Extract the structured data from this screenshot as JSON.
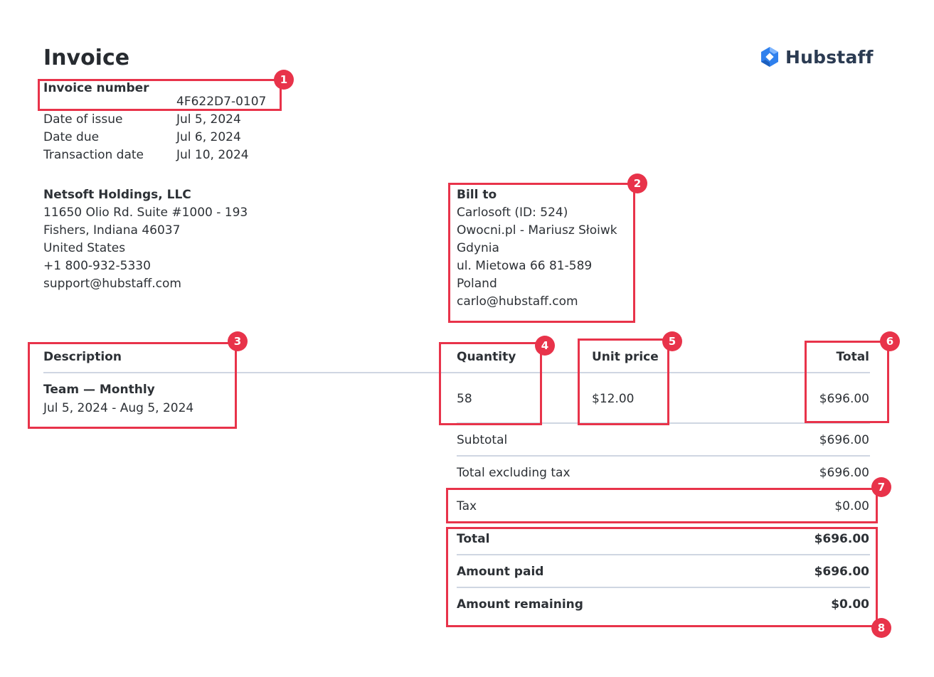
{
  "header": {
    "title": "Invoice",
    "brand": "Hubstaff"
  },
  "invoice_meta": {
    "number_label": "Invoice number",
    "number_value": "4F622D7-0107",
    "rows": [
      {
        "label": "Date of issue",
        "value": "Jul 5, 2024"
      },
      {
        "label": "Date due",
        "value": "Jul 6, 2024"
      },
      {
        "label": "Transaction date",
        "value": "Jul 10, 2024"
      }
    ]
  },
  "seller": {
    "name": "Netsoft Holdings, LLC",
    "lines": [
      "11650 Olio Rd. Suite #1000 - 193",
      "Fishers, Indiana 46037",
      "United States",
      "+1 800-932-5330",
      "support@hubstaff.com"
    ]
  },
  "bill_to": {
    "label": "Bill to",
    "lines": [
      "Carlosoft (ID: 524)",
      "Owocni.pl - Mariusz Słoiwk",
      "Gdynia",
      "ul. Mietowa 66 81-589",
      "Poland",
      "carlo@hubstaff.com"
    ]
  },
  "line_items": {
    "headers": {
      "description": "Description",
      "quantity": "Quantity",
      "unit_price": "Unit price",
      "total": "Total"
    },
    "rows": [
      {
        "name": "Team — Monthly",
        "period": "Jul 5, 2024 - Aug 5, 2024",
        "quantity": "58",
        "unit_price": "$12.00",
        "total": "$696.00"
      }
    ]
  },
  "summary": [
    {
      "label": "Subtotal",
      "value": "$696.00",
      "bold": false
    },
    {
      "label": "Total excluding tax",
      "value": "$696.00",
      "bold": false
    },
    {
      "label": "Tax",
      "value": "$0.00",
      "bold": false
    },
    {
      "label": "Total",
      "value": "$696.00",
      "bold": true
    },
    {
      "label": "Amount paid",
      "value": "$696.00",
      "bold": true
    },
    {
      "label": "Amount remaining",
      "value": "$0.00",
      "bold": true
    }
  ],
  "annotations": [
    "1",
    "2",
    "3",
    "4",
    "5",
    "6",
    "7",
    "8"
  ],
  "colors": {
    "annotation": "#e8334a",
    "divider": "#cfd6e2",
    "text": "#2d3136",
    "logo_blue": "#2f80ed",
    "logo_dark": "#2b3b52"
  }
}
